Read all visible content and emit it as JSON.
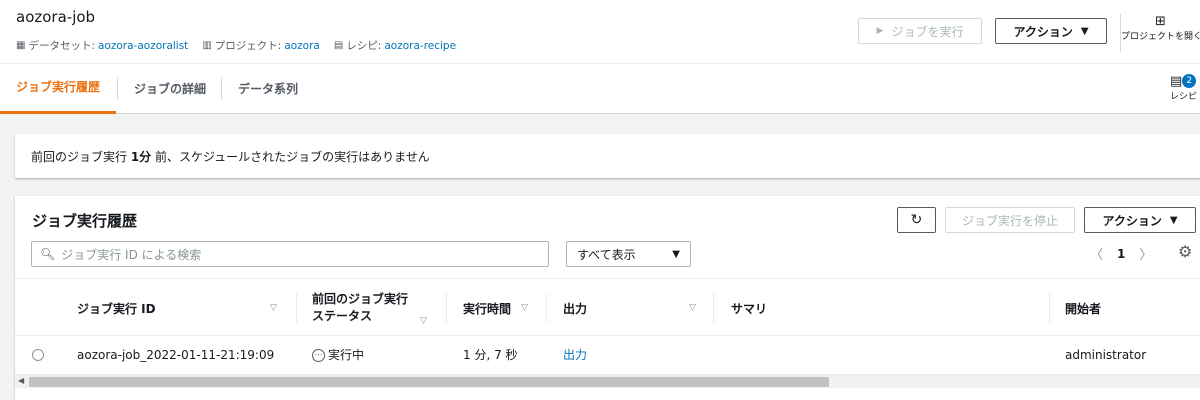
{
  "header": {
    "title": "aozora-job",
    "meta": [
      {
        "icon": "table-icon",
        "label": "データセット:",
        "value": "aozora-aozoralist"
      },
      {
        "icon": "grid-icon",
        "label": "プロジェクト:",
        "value": "aozora"
      },
      {
        "icon": "list-icon",
        "label": "レシピ:",
        "value": "aozora-recipe"
      }
    ],
    "run_button": "ジョブを実行",
    "actions_button": "アクション",
    "open_project": "プロジェクトを開く"
  },
  "tabs": [
    "ジョブ実行履歴",
    "ジョブの詳細",
    "データ系列"
  ],
  "recipe_side": {
    "badge": "2",
    "label": "レシピ"
  },
  "notice": {
    "prefix": "前回のジョブ実行 ",
    "bold": "1分",
    "suffix": " 前、スケジュールされたジョブの実行はありません"
  },
  "panel": {
    "title": "ジョブ実行履歴",
    "refresh_icon": "refresh-icon",
    "stop_button": "ジョブ実行を停止",
    "actions_button": "アクション",
    "search_placeholder": "ジョブ実行 ID による検索",
    "filter_value": "すべて表示",
    "page": "1"
  },
  "table": {
    "headers": [
      "ジョブ実行 ID",
      "前回のジョブ実行\nステータス",
      "実行時間",
      "出力",
      "サマリ",
      "開始者"
    ],
    "rows": [
      {
        "id": "aozora-job_2022-01-11-21:19:09",
        "status": "実行中",
        "duration": "1 分, 7 秒",
        "output": "出力",
        "summary": "",
        "started_by": "administrator"
      }
    ]
  },
  "colors": {
    "accent": "#ec7211",
    "link": "#0073bb",
    "text": "#16191f"
  }
}
